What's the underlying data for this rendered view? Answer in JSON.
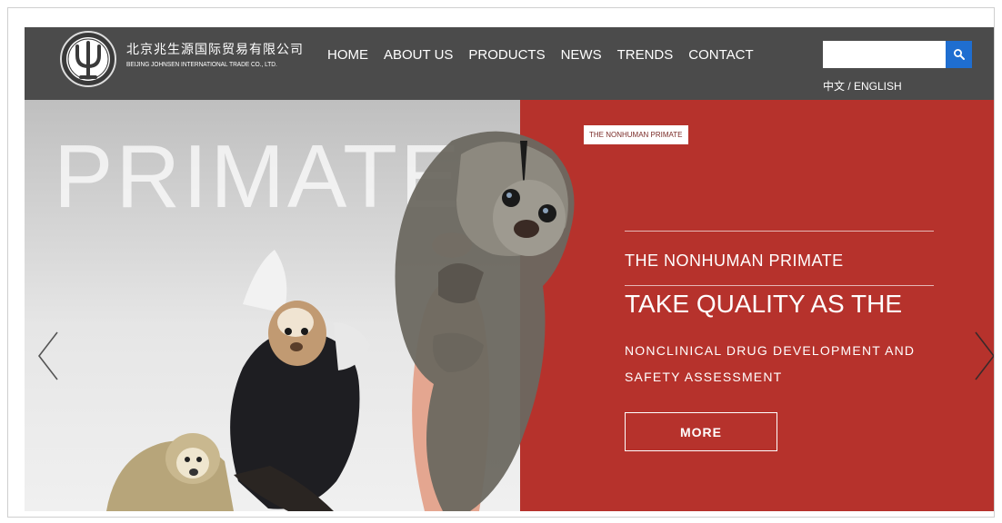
{
  "brand": {
    "name_cn": "北京兆生源国际贸易有限公司",
    "name_en": "BEIJING JOHNSEN INTERNATIONAL TRADE CO., LTD."
  },
  "nav": {
    "items": [
      {
        "label": "HOME"
      },
      {
        "label": "ABOUT US"
      },
      {
        "label": "PRODUCTS"
      },
      {
        "label": "NEWS"
      },
      {
        "label": "TRENDS"
      },
      {
        "label": "CONTACT"
      }
    ]
  },
  "search": {
    "placeholder": ""
  },
  "language": {
    "label": "中文 / ENGLISH"
  },
  "hero": {
    "watermark": "PRIMATE",
    "tag": "THE NONHUMAN PRIMATE",
    "heading": "THE NONHUMAN PRIMATE",
    "subheading": "TAKE QUALITY AS THE",
    "description": "NONCLINICAL DRUG DEVELOPMENT AND SAFETY ASSESSMENT",
    "button_label": "MORE"
  },
  "colors": {
    "header_bg": "#4b4b4b",
    "hero_red": "#b6322c",
    "search_blue": "#1f6ed0"
  },
  "icons": {
    "search": "search-icon",
    "prev": "chevron-left-icon",
    "next": "chevron-right-icon",
    "logo": "psi-logo-icon"
  }
}
